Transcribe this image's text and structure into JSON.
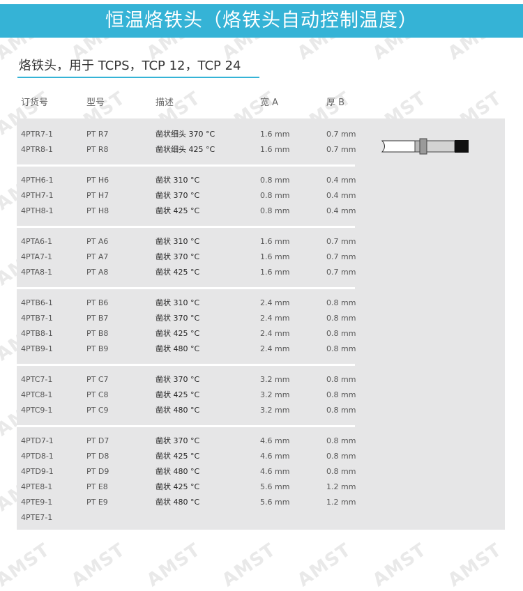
{
  "banner": {
    "title": "恒温烙铁头（烙铁头自动控制温度）"
  },
  "subtitle": "烙铁头，用于 TCPS，TCP 12，TCP 24",
  "watermark": "AMST",
  "table": {
    "headers": [
      "订货号",
      "型号",
      "描述",
      "宽 A",
      "厚 B"
    ],
    "groups": [
      [
        [
          "4PTR7-1",
          "PT R7",
          "凿状细头  370 °C",
          "1.6 mm",
          "0.7 mm"
        ],
        [
          "4PTR8-1",
          "PT R8",
          "凿状细头  425 °C",
          "1.6 mm",
          "0.7 mm"
        ]
      ],
      [
        [
          "4PTH6-1",
          "PT H6",
          "凿状  310 °C",
          "0.8 mm",
          "0.4 mm"
        ],
        [
          "4PTH7-1",
          "PT H7",
          "凿状  370 °C",
          "0.8 mm",
          "0.4 mm"
        ],
        [
          "4PTH8-1",
          "PT H8",
          "凿状  425 °C",
          "0.8 mm",
          "0.4 mm"
        ]
      ],
      [
        [
          "4PTA6-1",
          "PT A6",
          "凿状  310 °C",
          "1.6 mm",
          "0.7 mm"
        ],
        [
          "4PTA7-1",
          "PT A7",
          "凿状  370 °C",
          "1.6 mm",
          "0.7 mm"
        ],
        [
          "4PTA8-1",
          "PT A8",
          "凿状  425 °C",
          "1.6 mm",
          "0.7 mm"
        ]
      ],
      [
        [
          "4PTB6-1",
          "PT B6",
          "凿状  310 °C",
          "2.4 mm",
          "0.8 mm"
        ],
        [
          "4PTB7-1",
          "PT B7",
          "凿状  370 °C",
          "2.4 mm",
          "0.8 mm"
        ],
        [
          "4PTB8-1",
          "PT B8",
          "凿状  425 °C",
          "2.4 mm",
          "0.8 mm"
        ],
        [
          "4PTB9-1",
          "PT B9",
          "凿状   480 °C",
          "2.4 mm",
          "0.8 mm"
        ]
      ],
      [
        [
          "4PTC7-1",
          "PT C7",
          "凿状   370 °C",
          "3.2 mm",
          "0.8 mm"
        ],
        [
          "4PTC8-1",
          "PT C8",
          "凿状   425 °C",
          "3.2 mm",
          "0.8 mm"
        ],
        [
          "4PTC9-1",
          "PT C9",
          "凿状   480 °C",
          "3.2 mm",
          "0.8 mm"
        ]
      ],
      [
        [
          "4PTD7-1",
          "PT D7",
          "凿状   370 °C",
          "4.6 mm",
          "0.8 mm"
        ],
        [
          "4PTD8-1",
          "PT D8",
          "凿状   425 °C",
          "4.6 mm",
          "0.8 mm"
        ],
        [
          "4PTD9-1",
          "PT D9",
          "凿状   480 °C",
          "4.6 mm",
          "0.8 mm"
        ],
        [
          "4PTE8-1",
          "PT E8",
          "凿状   425 °C",
          "5.6 mm",
          "1.2 mm"
        ],
        [
          "4PTE9-1",
          "PT E9",
          "凿状   480 °C",
          "5.6 mm",
          "1.2 mm"
        ],
        [
          "4PTE7-1",
          "",
          "",
          "",
          ""
        ]
      ]
    ]
  },
  "colors": {
    "accent": "#35b3d6",
    "table_bg": "#e6e6e7",
    "text": "#555555"
  },
  "icons": {
    "tip": "soldering-tip-icon"
  }
}
